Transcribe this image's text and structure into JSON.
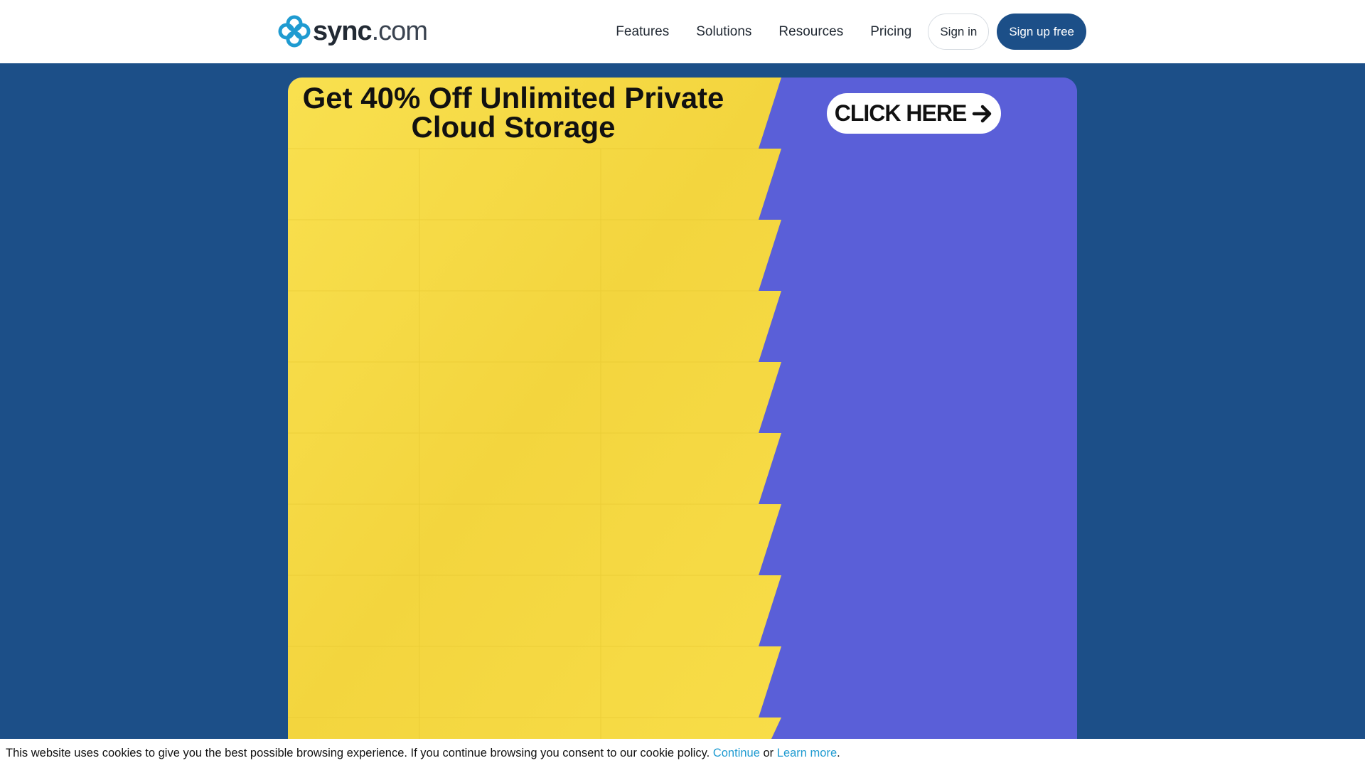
{
  "brand": {
    "name_bold": "sync",
    "name_light": ".com",
    "logo_color": "#1f9bd1"
  },
  "nav": {
    "items": [
      {
        "label": "Features"
      },
      {
        "label": "Solutions"
      },
      {
        "label": "Resources"
      },
      {
        "label": "Pricing"
      }
    ],
    "signin_label": "Sign in",
    "signup_label": "Sign up free"
  },
  "banner": {
    "title": "Get 40% Off Unlimited Private Cloud Storage",
    "cta_label": "CLICK HERE",
    "left_color": "#f7dc47",
    "right_color": "#5a5fd8"
  },
  "cookie": {
    "text": "This website uses cookies to give you the best possible browsing experience. If you continue browsing you consent to our cookie policy.",
    "continue_label": "Continue",
    "or_text": "or",
    "learn_more_label": "Learn more",
    "end_punct": "."
  },
  "colors": {
    "page_background": "#1c4f88",
    "primary_button": "#1c4f88",
    "link": "#1f9bd1"
  }
}
